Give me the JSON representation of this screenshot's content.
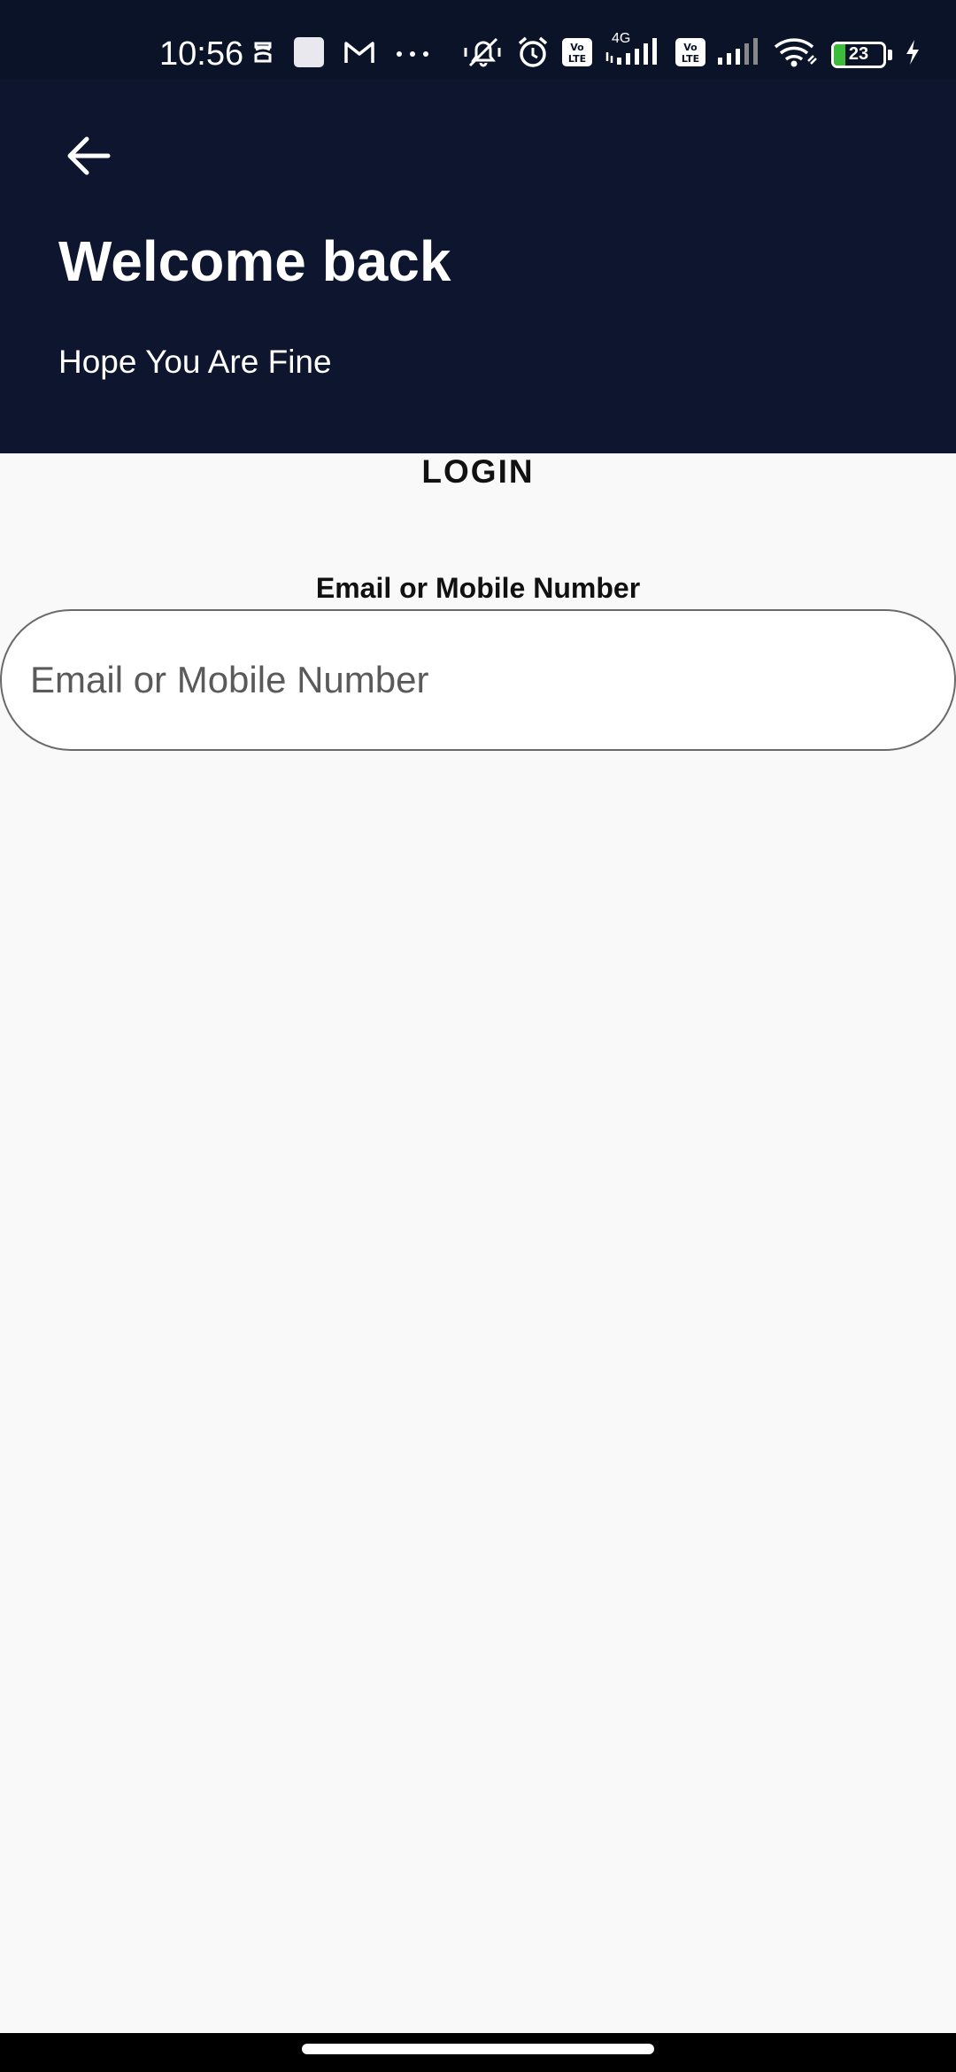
{
  "status_bar": {
    "time": "10:56",
    "battery_level": "23",
    "battery_fraction": 0.23,
    "network_label": "4G",
    "left_icons": [
      "data-saver-icon",
      "square-notification-icon",
      "gmail-icon",
      "more-dots-icon"
    ],
    "right_icons": [
      "mute-icon",
      "alarm-icon",
      "volte-icon",
      "signal-4g-icon",
      "volte-icon",
      "signal-icon",
      "wifi-icon",
      "battery-icon",
      "charging-icon"
    ]
  },
  "header": {
    "back_icon": "arrow-left-icon",
    "title": "Welcome back",
    "subtitle": "Hope You Are Fine"
  },
  "login": {
    "heading": "LOGIN",
    "email_label": "Email or Mobile Number",
    "email_placeholder": "Email or Mobile Number",
    "email_value": ""
  },
  "colors": {
    "header_bg": "#0e152e",
    "status_bg": "#0b1328",
    "page_bg": "#f9f9f9",
    "battery_green": "#3dbb3d"
  }
}
